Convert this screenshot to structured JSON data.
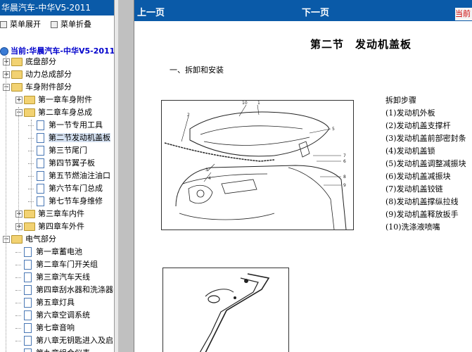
{
  "left": {
    "title": "华晨汽车-中华V5-2011",
    "expand_label": "菜单展开",
    "collapse_label": "菜单折叠",
    "current_label": "当前:华晨汽车-中华V5-2011",
    "tree": [
      {
        "label": "底盘部分",
        "kind": "folder",
        "level": 0,
        "toggle": "+"
      },
      {
        "label": "动力总成部分",
        "kind": "folder",
        "level": 0,
        "toggle": "+"
      },
      {
        "label": "车身附件部分",
        "kind": "folder",
        "level": 0,
        "toggle": "-"
      },
      {
        "label": "第一章车身附件",
        "kind": "folder",
        "level": 1,
        "toggle": "+"
      },
      {
        "label": "第二章车身总成",
        "kind": "folder",
        "level": 1,
        "toggle": "-"
      },
      {
        "label": "第一节专用工具",
        "kind": "page",
        "level": 2
      },
      {
        "label": "第二节发动机盖板",
        "kind": "page",
        "level": 2,
        "selected": true
      },
      {
        "label": "第三节尾门",
        "kind": "page",
        "level": 2
      },
      {
        "label": "第四节翼子板",
        "kind": "page",
        "level": 2
      },
      {
        "label": "第五节燃油注油口",
        "kind": "page",
        "level": 2
      },
      {
        "label": "第六节车门总成",
        "kind": "page",
        "level": 2
      },
      {
        "label": "第七节车身维修",
        "kind": "page",
        "level": 2
      },
      {
        "label": "第三章车内件",
        "kind": "folder",
        "level": 1,
        "toggle": "+"
      },
      {
        "label": "第四章车外件",
        "kind": "folder",
        "level": 1,
        "toggle": "+"
      },
      {
        "label": "电气部分",
        "kind": "folder",
        "level": 0,
        "toggle": "-"
      },
      {
        "label": "第一章蓄电池",
        "kind": "page",
        "level": 1
      },
      {
        "label": "第二章车门开关组",
        "kind": "page",
        "level": 1
      },
      {
        "label": "第三章汽车天线",
        "kind": "page",
        "level": 1
      },
      {
        "label": "第四章刮水器和洗涤器",
        "kind": "page",
        "level": 1
      },
      {
        "label": "第五章灯具",
        "kind": "page",
        "level": 1
      },
      {
        "label": "第六章空调系统",
        "kind": "page",
        "level": 1
      },
      {
        "label": "第七章音响",
        "kind": "page",
        "level": 1
      },
      {
        "label": "第八章无钥匙进入及启",
        "kind": "page",
        "level": 1
      },
      {
        "label": "第九章组合仪表",
        "kind": "page",
        "level": 1
      }
    ]
  },
  "nav": {
    "prev": "上一页",
    "next": "下一页",
    "right": "当前"
  },
  "content": {
    "section_title": "第二节　发动机盖板",
    "subtitle": "一、拆卸和安装",
    "steps": [
      "拆卸步骤",
      "(1)发动机外板",
      "(2)发动机盖支撑杆",
      "(3)发动机盖前部密封条",
      "(4)发动机盖锁",
      "(5)发动机盖调整减振块",
      "(6)发动机盖减振块",
      "(7)发动机盖铰链",
      "(8)发动机盖撑纵拉线",
      "(9)发动机盖释放扳手",
      "(10)洗涤液喷嘴"
    ],
    "callouts": [
      "10",
      "1",
      "2",
      "3",
      "4",
      "5",
      "6",
      "7",
      "8",
      "9"
    ]
  }
}
